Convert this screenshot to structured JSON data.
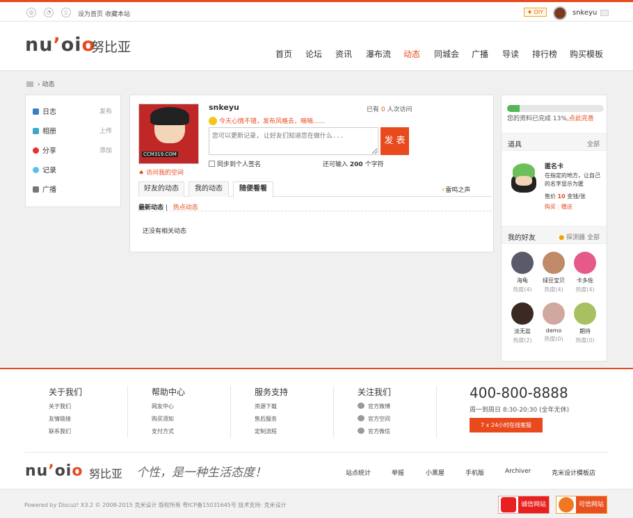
{
  "topbar": {
    "set_home": "设为首页",
    "bookmark": "收藏本站",
    "diy_label": "DIY",
    "username": "snkeyu"
  },
  "header": {
    "logo": "nuʼoio",
    "logo_cn": "努比亚",
    "nav": [
      "首页",
      "论坛",
      "资讯",
      "瀑布流",
      "动态",
      "同城会",
      "广播",
      "导读",
      "排行榜",
      "购买模板"
    ],
    "active_nav": "动态",
    "accent_color": "#e8491d"
  },
  "breadcrumb": {
    "current": "动态"
  },
  "left_nav": [
    {
      "label": "日志",
      "action": "发布",
      "icon": "blog-icon"
    },
    {
      "label": "相册",
      "action": "上传",
      "icon": "album-icon"
    },
    {
      "label": "分享",
      "action": "添加",
      "icon": "share-icon"
    },
    {
      "label": "记录",
      "action": "",
      "icon": "record-icon"
    },
    {
      "label": "广播",
      "action": "",
      "icon": "broadcast-icon"
    }
  ],
  "profile": {
    "username": "snkeyu",
    "avatar_tag": "CCM319.COM",
    "visits_prefix": "已有",
    "visits_count": "0",
    "visits_suffix": "人次访问",
    "mood": "今天心情不错，发布风格去，嘀嘀......",
    "textarea_placeholder": "您可以更新记录, 让好友们知道您在做什么...",
    "publish_label": "发 表",
    "sync_label": "同步到个人签名",
    "chars_prefix": "还可输入",
    "chars_count": "200",
    "chars_suffix": "个字符",
    "visit_space": "访问我的空间"
  },
  "feed": {
    "tabs": [
      "好友的动态",
      "我的动态",
      "随便看看"
    ],
    "active_tab": "随便看看",
    "thunder": "雷鸣之声",
    "sub_latest": "最新动态",
    "sub_hot": "热点动态",
    "empty": "还没有相关动态"
  },
  "sidebar": {
    "progress_percent": 13,
    "progress_text": "您的资料已完成 13%,",
    "progress_link": "点此完善",
    "tools_title": "道具",
    "tools_more": "全部",
    "tool": {
      "name": "匿名卡",
      "desc": "在指定的地方，让自己的名字显示为匿",
      "price_prefix": "售价",
      "price_value": "10",
      "price_suffix": "金钱/张",
      "buy": "购买",
      "gift": "赠送"
    },
    "friends_title": "我的好友",
    "friends_detector": "探测器",
    "friends_more": "全部",
    "friends": [
      {
        "name": "海龟",
        "heat": "热度(4)",
        "color": "#5a5a6a"
      },
      {
        "name": "绿豆宝贝",
        "heat": "热度(4)",
        "color": "#c08a6a"
      },
      {
        "name": "卡多佐",
        "heat": "热度(4)",
        "color": "#e65a8a"
      },
      {
        "name": "淡无盐",
        "heat": "热度(2)",
        "color": "#3a2a22"
      },
      {
        "name": "demo",
        "heat": "热度(0)",
        "color": "#d0a8a0"
      },
      {
        "name": "期待",
        "heat": "热度(0)",
        "color": "#a8c060"
      }
    ]
  },
  "footer": {
    "cols": [
      {
        "title": "关于我们",
        "links": [
          "关于我们",
          "友情链接",
          "联系我们"
        ]
      },
      {
        "title": "帮助中心",
        "links": [
          "网友中心",
          "购买须知",
          "支付方式"
        ]
      },
      {
        "title": "服务支持",
        "links": [
          "资源下载",
          "售后服务",
          "定制流程"
        ]
      },
      {
        "title": "关注我们",
        "links": [
          "官方微博",
          "官方空间",
          "官方微信"
        ]
      }
    ],
    "phone": "400-800-8888",
    "hours": "周一到周日 8:30-20:30 (全年无休)",
    "service_button": "7 x 24小时在线客服",
    "slogan": "个性，是一种生活态度！",
    "bottom_links": [
      "站点统计",
      "举报",
      "小黑屋",
      "手机版",
      "Archiver",
      "克米设计模板店"
    ],
    "copyright": "Powered by Discuz! X3.2 © 2008-2015 克米设计 版权所有 粤ICP备15031645号 技术支持: 克米设计",
    "badge1": "诚信网站",
    "badge2": "可信网站"
  }
}
